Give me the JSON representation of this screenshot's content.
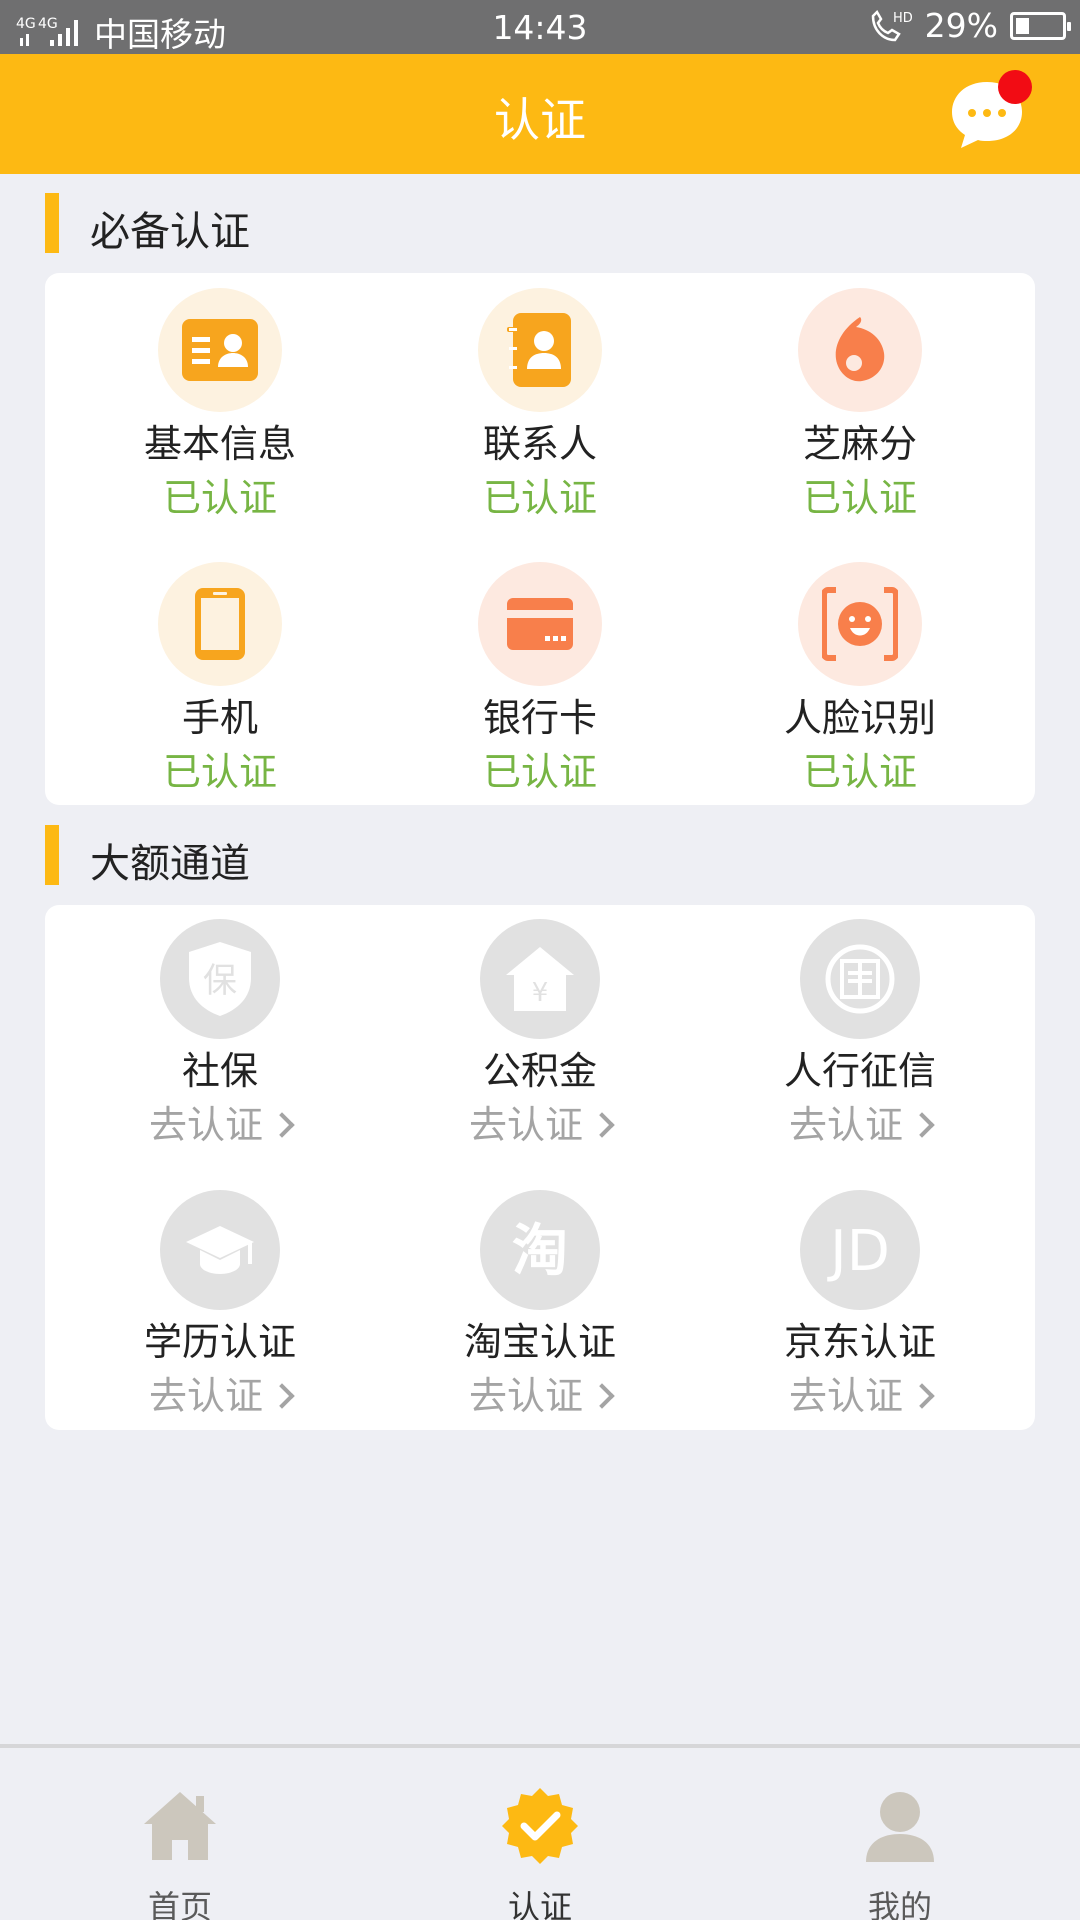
{
  "status_bar": {
    "carrier": "中国移动",
    "time": "14:43",
    "battery": "29%",
    "battery_level": 0.29,
    "network": "4G"
  },
  "header": {
    "title": "认证"
  },
  "required": {
    "title": "必备认证",
    "items": [
      {
        "name": "基本信息",
        "status": "已认证",
        "icon": "id-card-icon"
      },
      {
        "name": "联系人",
        "status": "已认证",
        "icon": "contacts-book-icon"
      },
      {
        "name": "芝麻分",
        "status": "已认证",
        "icon": "sesame-seed-icon"
      },
      {
        "name": "手机",
        "status": "已认证",
        "icon": "mobile-phone-icon"
      },
      {
        "name": "银行卡",
        "status": "已认证",
        "icon": "bank-card-icon"
      },
      {
        "name": "人脸识别",
        "status": "已认证",
        "icon": "face-scan-icon"
      }
    ]
  },
  "large": {
    "title": "大额通道",
    "items": [
      {
        "name": "社保",
        "status": "去认证",
        "icon": "social-security-shield-icon",
        "icon_text": "保"
      },
      {
        "name": "公积金",
        "status": "去认证",
        "icon": "housing-fund-house-icon",
        "icon_text": "¥"
      },
      {
        "name": "人行征信",
        "status": "去认证",
        "icon": "credit-bank-seal-icon"
      },
      {
        "name": "学历认证",
        "status": "去认证",
        "icon": "graduation-cap-icon"
      },
      {
        "name": "淘宝认证",
        "status": "去认证",
        "icon": "taobao-icon",
        "icon_text": "淘"
      },
      {
        "name": "京东认证",
        "status": "去认证",
        "icon": "jd-icon",
        "icon_text": "JD"
      }
    ]
  },
  "tabs": [
    {
      "label": "首页",
      "icon": "home-icon",
      "active": false
    },
    {
      "label": "认证",
      "icon": "verified-badge-icon",
      "active": true
    },
    {
      "label": "我的",
      "icon": "user-icon",
      "active": false
    }
  ],
  "colors": {
    "accent": "#fdb913",
    "verified": "#77b544",
    "pending": "#a4a4a4",
    "icon_orange": "#f7a51e",
    "icon_coral": "#f87f4b",
    "icon_grey_bg": "#e1e1e1"
  }
}
